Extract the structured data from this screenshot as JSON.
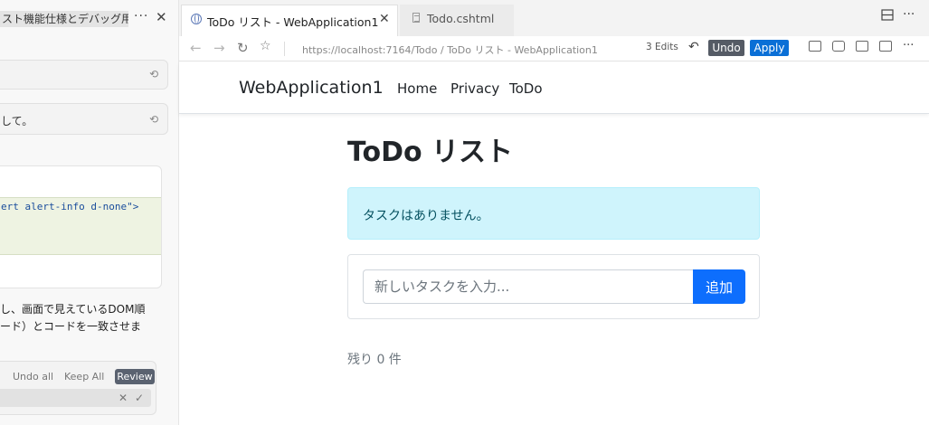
{
  "chat_pane": {
    "title": "スト機能仕様とデバッグ用",
    "more": "···",
    "close": "✕",
    "undo_icon": "undo-icon",
    "message_2": "して。",
    "code_line": "ert alert-info d-none\">",
    "reply_line1": "し、画面で見えているDOM順",
    "reply_line2": "ード）とコードを一致させま",
    "review": {
      "undo_all": "Undo all",
      "keep_all": "Keep All",
      "review": "Review",
      "reject": "✕",
      "accept": "✓"
    }
  },
  "browser": {
    "tabs": [
      {
        "label": "ToDo リスト - WebApplication1",
        "icon": "globe-icon"
      },
      {
        "label": "Todo.cshtml",
        "icon": "file-icon"
      }
    ],
    "tab_close": "✕",
    "window_more": "···",
    "url": "https://localhost:7164/Todo / ToDo リスト - WebApplication1",
    "edits": "3 Edits",
    "undo_label": "Undo",
    "apply_label": "Apply",
    "toolbar_more": "···"
  },
  "page": {
    "brand": "WebApplication1",
    "nav": [
      "Home",
      "Privacy",
      "ToDo"
    ],
    "title": "ToDo リスト",
    "alert": "タスクはありません。",
    "input_placeholder": "新しいタスクを入力...",
    "add_button": "追加",
    "remaining": "残り 0 件",
    "colors": {
      "primary": "#0d6efd",
      "alert_bg": "#cff4fc",
      "alert_text": "#055160"
    }
  }
}
